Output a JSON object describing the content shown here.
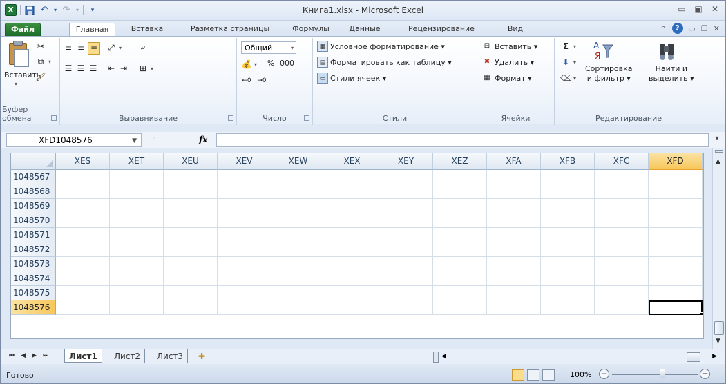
{
  "app": {
    "title": "Книга1.xlsx - Microsoft Excel",
    "accent": "#1f7a3a"
  },
  "tabs": [
    "Файл",
    "Главная",
    "Вставка",
    "Разметка страницы",
    "Формулы",
    "Данные",
    "Рецензирование",
    "Вид"
  ],
  "ribbon": {
    "clipboard": {
      "paste": "Вставить",
      "label": "Буфер обмена"
    },
    "alignment": {
      "label": "Выравнивание"
    },
    "number": {
      "format": "Общий",
      "label": "Число",
      "percent": "%",
      "thousands": "000"
    },
    "styles": {
      "conditional": "Условное форматирование ▾",
      "as_table": "Форматировать как таблицу ▾",
      "cell_styles": "Стили ячеек ▾",
      "label": "Стили"
    },
    "cells": {
      "insert": "Вставить ▾",
      "delete": "Удалить ▾",
      "format": "Формат ▾",
      "label": "Ячейки"
    },
    "editing": {
      "sort_line1": "Сортировка",
      "sort_line2": "и фильтр ▾",
      "find_line1": "Найти и",
      "find_line2": "выделить ▾",
      "label": "Редактирование"
    }
  },
  "formula_bar": {
    "name_box": "XFD1048576",
    "fx": "fx",
    "value": ""
  },
  "grid": {
    "columns": [
      "XES",
      "XET",
      "XEU",
      "XEV",
      "XEW",
      "XEX",
      "XEY",
      "XEZ",
      "XFA",
      "XFB",
      "XFC",
      "XFD"
    ],
    "selected_column": "XFD",
    "rows": [
      "1048567",
      "1048568",
      "1048569",
      "1048570",
      "1048571",
      "1048572",
      "1048573",
      "1048574",
      "1048575",
      "1048576"
    ],
    "selected_row": "1048576"
  },
  "sheets": [
    "Лист1",
    "Лист2",
    "Лист3"
  ],
  "active_sheet": "Лист1",
  "status": {
    "text": "Готово",
    "zoom": "100%"
  }
}
